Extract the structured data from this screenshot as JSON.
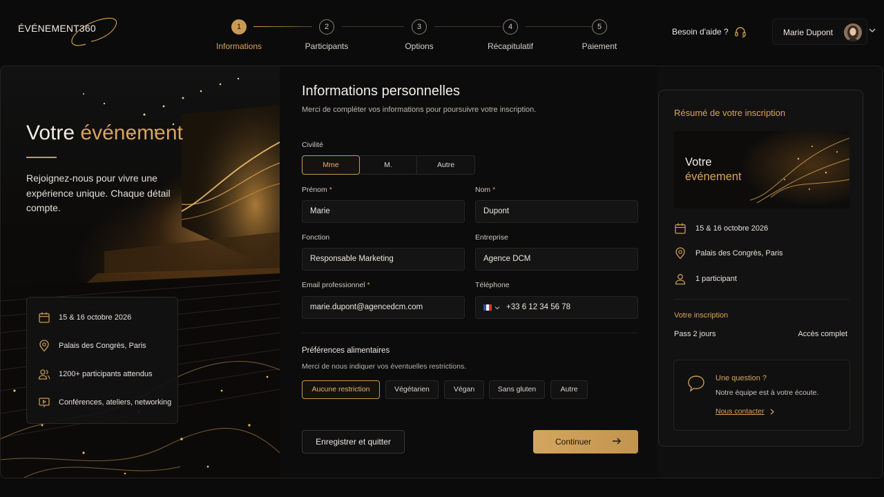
{
  "brand": {
    "name": "ÉVÉNEMENT360"
  },
  "colors": {
    "accent": "#c99a55",
    "background": "#0b0b0b",
    "panel": "#121212"
  },
  "steps": [
    {
      "number": "1",
      "label": "Informations",
      "active": true
    },
    {
      "number": "2",
      "label": "Participants",
      "active": false
    },
    {
      "number": "3",
      "label": "Options",
      "active": false
    },
    {
      "number": "4",
      "label": "Récapitulatif",
      "active": false
    },
    {
      "number": "5",
      "label": "Paiement",
      "active": false
    }
  ],
  "help": {
    "label": "Besoin d'aide ?",
    "icon": "headset-icon"
  },
  "user": {
    "name": "Marie Dupont",
    "icon": "chevron-down-icon"
  },
  "hero": {
    "title_prefix": "Votre",
    "title_accent": "événement",
    "text": "Rejoignez-nous pour vivre une expérience unique. Chaque détail compte.",
    "details": [
      {
        "icon": "calendar-icon",
        "label": "15 & 16 octobre 2026"
      },
      {
        "icon": "location-pin-icon",
        "label": "Palais des Congrès, Paris"
      },
      {
        "icon": "users-icon",
        "label": "1200+ participants attendus"
      },
      {
        "icon": "presentation-icon",
        "label": "Conférences, ateliers, networking"
      }
    ]
  },
  "form": {
    "title": "Informations personnelles",
    "subtitle": "Merci de compléter vos informations pour poursuivre votre inscription.",
    "civilite": {
      "label": "Civilité",
      "options": [
        "Mme",
        "M.",
        "Autre"
      ],
      "selected": "Mme"
    },
    "prenom": {
      "label": "Prénom",
      "required_mark": "*",
      "value": "Marie"
    },
    "nom": {
      "label": "Nom",
      "required_mark": "*",
      "value": "Dupont"
    },
    "fonction": {
      "label": "Fonction",
      "value": "Responsable Marketing"
    },
    "entreprise": {
      "label": "Entreprise",
      "value": "Agence DCM"
    },
    "email": {
      "label": "Email professionnel",
      "required_mark": "*",
      "value": "marie.dupont@agencedcm.com"
    },
    "telephone": {
      "label": "Téléphone",
      "value": "+33 6 12 34 56 78",
      "country_icon": "france-flag-icon"
    },
    "preferences": {
      "title": "Préférences alimentaires",
      "subtitle": "Merci de nous indiquer vos éventuelles restrictions.",
      "options": [
        "Aucune restriction",
        "Végétarien",
        "Végan",
        "Sans gluten",
        "Autre"
      ],
      "selected": "Aucune restriction"
    },
    "save_label": "Enregistrer et quitter",
    "continue_label": "Continuer"
  },
  "summary": {
    "title": "Résumé de votre inscription",
    "banner_prefix": "Votre",
    "banner_accent": "événement",
    "rows": [
      {
        "icon": "calendar-icon",
        "label": "15 & 16 octobre 2026"
      },
      {
        "icon": "location-pin-icon",
        "label": "Palais des Congrès, Paris"
      },
      {
        "icon": "user-icon",
        "label": "1 participant"
      }
    ],
    "inscription_label": "Votre inscription",
    "pass": "Pass 2 jours",
    "access": "Accès complet",
    "question": {
      "title": "Une question ?",
      "text": "Notre équipe est à votre écoute.",
      "link": "Nous contacter"
    }
  }
}
